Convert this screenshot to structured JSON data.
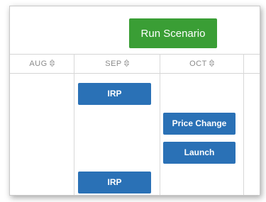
{
  "toolbar": {
    "run_label": "Run Scenario",
    "run_color": "#3a9e35"
  },
  "columns": [
    {
      "label": "AUG"
    },
    {
      "label": "SEP"
    },
    {
      "label": "OCT"
    }
  ],
  "sort_icon": "sort-up-down-icon",
  "events": [
    {
      "label": "IRP",
      "month": "SEP"
    },
    {
      "label": "Price Change",
      "month": "OCT"
    },
    {
      "label": "Launch",
      "month": "OCT"
    },
    {
      "label": "IRP",
      "month": "SEP"
    }
  ],
  "event_color": "#2a71b6"
}
